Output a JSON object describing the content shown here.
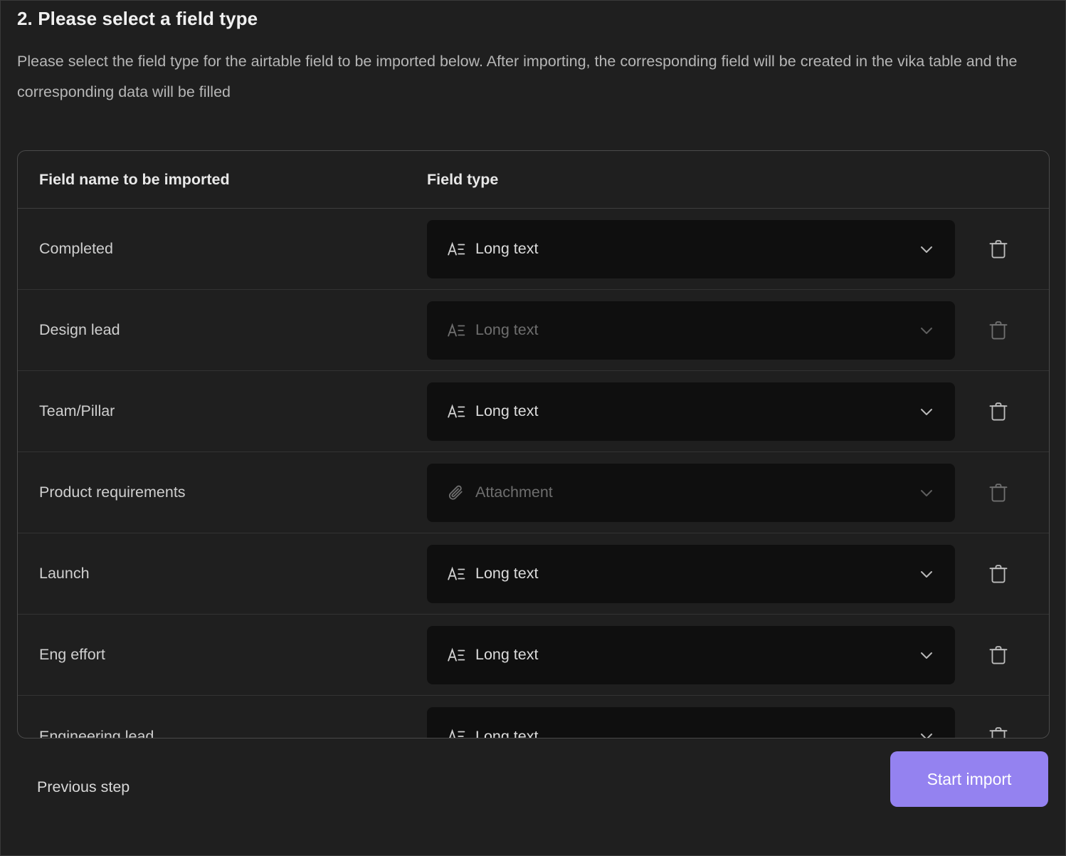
{
  "header": {
    "title": "2. Please select a field type",
    "description": "Please select the field type for the airtable field to be imported below. After importing, the corresponding field will be created in the vika table and the corresponding data will be filled"
  },
  "table": {
    "columns": {
      "field_name": "Field name to be imported",
      "field_type": "Field type"
    },
    "rows": [
      {
        "name": "Completed",
        "type": "Long text",
        "icon": "long-text-icon",
        "state": "active"
      },
      {
        "name": "Design lead",
        "type": "Long text",
        "icon": "long-text-icon",
        "state": "dimmed"
      },
      {
        "name": "Team/Pillar",
        "type": "Long text",
        "icon": "long-text-icon",
        "state": "active"
      },
      {
        "name": "Product requirements",
        "type": "Attachment",
        "icon": "attachment-icon",
        "state": "dimmed"
      },
      {
        "name": "Launch",
        "type": "Long text",
        "icon": "long-text-icon",
        "state": "active"
      },
      {
        "name": "Eng effort",
        "type": "Long text",
        "icon": "long-text-icon",
        "state": "active"
      },
      {
        "name": "Engineering lead",
        "type": "Long text",
        "icon": "long-text-icon",
        "state": "active"
      }
    ],
    "row_action_icon": "trash-icon",
    "dropdown_icon": "chevron-down-icon"
  },
  "footer": {
    "previous_label": "Previous step",
    "start_label": "Start import"
  },
  "colors": {
    "page_background": "#1f1f1f",
    "select_background": "#0f0f0f",
    "accent": "#9482f0",
    "border": "#4a4a4a",
    "text_primary": "#e8e8e8",
    "text_secondary": "#b6b6b6",
    "text_dimmed": "#6e6e6e"
  }
}
